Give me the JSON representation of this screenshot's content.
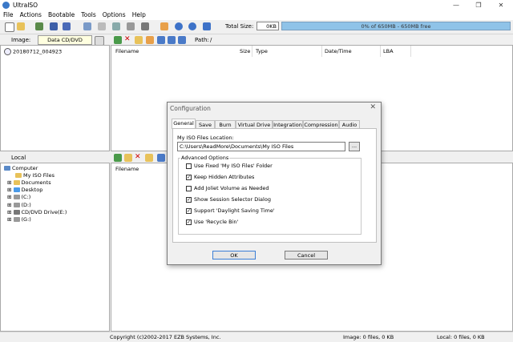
{
  "window": {
    "title": "UltraISO",
    "minimize": "—",
    "maximize": "❐",
    "close": "✕"
  },
  "menu": [
    "File",
    "Actions",
    "Bootable",
    "Tools",
    "Options",
    "Help"
  ],
  "toolbar": {
    "total_size_label": "Total Size:",
    "total_size_value": "0KB",
    "capacity_text": "0% of 650MB - 650MB free",
    "capacity_fraction": 0.0
  },
  "image_bar": {
    "label": "Image:",
    "type": "Data CD/DVD",
    "path_label": "Path:",
    "path_value": "/"
  },
  "image_tree": {
    "root": "20180712_004923"
  },
  "image_list": {
    "columns": [
      "Filename",
      "Size",
      "Type",
      "Date/Time",
      "LBA"
    ]
  },
  "local_bar": {
    "label": "Local"
  },
  "local_tree": [
    {
      "label": "Computer"
    },
    {
      "label": "My ISO Files"
    },
    {
      "label": "Documents"
    },
    {
      "label": "Desktop"
    },
    {
      "label": "(C:)"
    },
    {
      "label": "(D:)"
    },
    {
      "label": "CD/DVD Drive(E:)"
    },
    {
      "label": "(G:)"
    }
  ],
  "local_list": {
    "columns": [
      "Filename"
    ]
  },
  "status": {
    "copyright": "Copyright (c)2002-2017 EZB Systems, Inc.",
    "image": "Image: 0 files, 0 KB",
    "local": "Local: 0 files, 0 KB"
  },
  "dialog": {
    "title": "Configuration",
    "tabs": [
      "General",
      "Save",
      "Burn",
      "Virtual Drive",
      "Integration",
      "Compression",
      "Audio"
    ],
    "location_label": "My ISO Files Location:",
    "location_value": "C:\\Users\\ReadMore\\Documents\\My ISO Files",
    "browse_label": "...",
    "advanced_label": "Advanced Options",
    "options": [
      {
        "label": "Use Fixed 'My ISO Files' Folder",
        "checked": false
      },
      {
        "label": "Keep Hidden Attributes",
        "checked": true
      },
      {
        "label": "Add Joliet Volume as Needed",
        "checked": false
      },
      {
        "label": "Show Session Selector Dialog",
        "checked": true
      },
      {
        "label": "Support 'Daylight Saving Time'",
        "checked": true
      },
      {
        "label": "Use 'Recycle Bin'",
        "checked": true
      }
    ],
    "ok_label": "OK",
    "cancel_label": "Cancel"
  }
}
